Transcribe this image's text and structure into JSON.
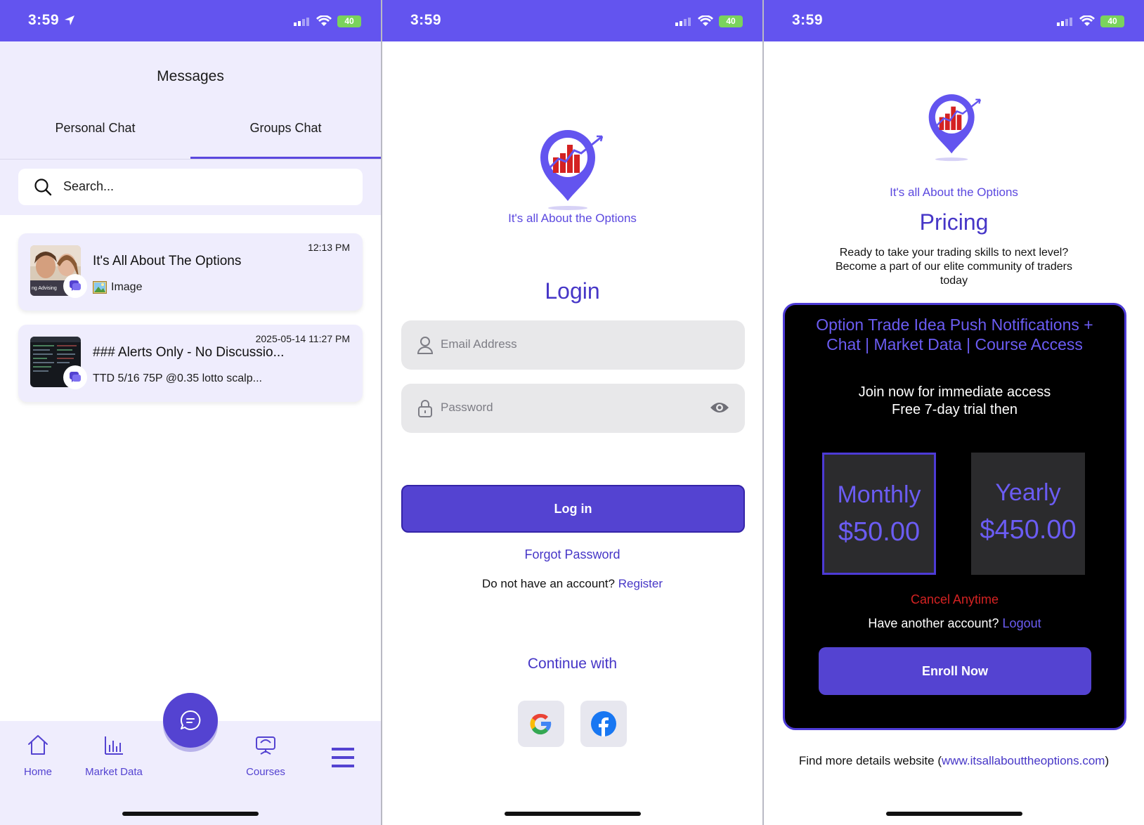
{
  "status": {
    "time": "3:59",
    "battery": "40"
  },
  "messages": {
    "title": "Messages",
    "tabs": [
      "Personal Chat",
      "Groups Chat"
    ],
    "search_placeholder": "Search...",
    "chats": [
      {
        "name": "It's All About The Options",
        "time": "12:13 PM",
        "preview": "Image",
        "preview_icon": "image-icon"
      },
      {
        "name": "### Alerts Only - No Discussio...",
        "time": "2025-05-14 11:27 PM",
        "preview": "TTD 5/16 75P @0.35 lotto scalp..."
      }
    ],
    "thumb_caption": "ng Advising",
    "nav": [
      "Home",
      "Market Data",
      "Courses"
    ]
  },
  "login": {
    "brand": "It's all About the Options",
    "title": "Login",
    "email_placeholder": "Email Address",
    "password_placeholder": "Password",
    "login_button": "Log in",
    "forgot": "Forgot Password",
    "no_account": "Do not have an account?",
    "register": "Register",
    "continue_with": "Continue with"
  },
  "pricing": {
    "brand": "It's all About the Options",
    "title": "Pricing",
    "description": "Ready to take your trading skills to next level? Become a part of our elite community of traders today",
    "plan_headline": "Option Trade Idea Push Notifications + Chat | Market Data | Course Access",
    "plan_sub1": "Join now for immediate access",
    "plan_sub2": "Free 7-day trial then",
    "plans": [
      {
        "name": "Monthly",
        "price": "$50.00"
      },
      {
        "name": "Yearly",
        "price": "$450.00"
      }
    ],
    "cancel": "Cancel Anytime",
    "another_account": "Have another account?",
    "logout": "Logout",
    "enroll": "Enroll Now",
    "details": "Find more details website (",
    "website": "www.itsallabouttheoptions.com",
    "details_end": ")"
  },
  "colors": {
    "accent": "#5443d1",
    "header": "#6354ef",
    "cancel": "#d42222"
  }
}
